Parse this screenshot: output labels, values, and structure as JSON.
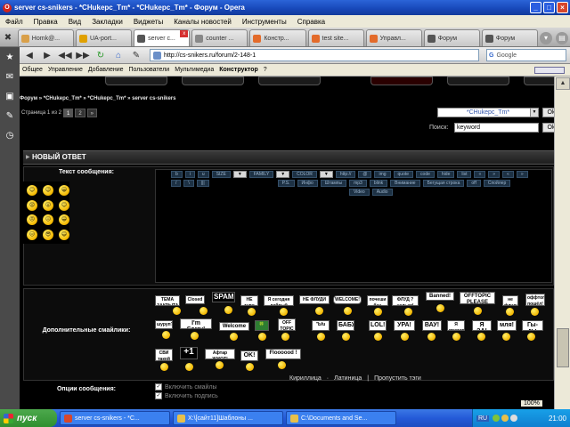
{
  "window": {
    "title": "server cs-snikers - *CHukepc_Tm* - *CHukepc_Tm* - Форум - Opera",
    "minimize": "_",
    "maximize": "□",
    "close": "×"
  },
  "menu": [
    "Файл",
    "Правка",
    "Вид",
    "Закладки",
    "Виджеты",
    "Каналы новостей",
    "Инструменты",
    "Справка"
  ],
  "tabs": [
    {
      "label": "Homk@...",
      "color": "#d9a04a"
    },
    {
      "label": "UA-port...",
      "color": "#e0a000"
    },
    {
      "label": "server c...",
      "color": "#555555",
      "active": true
    },
    {
      "label": "counter ...",
      "color": "#888888"
    },
    {
      "label": "Констр...",
      "color": "#e36b2b"
    },
    {
      "label": "test site...",
      "color": "#e36b2b"
    },
    {
      "label": "Управл...",
      "color": "#e36b2b"
    },
    {
      "label": "Форум",
      "color": "#555555"
    },
    {
      "label": "Форум",
      "color": "#555555"
    }
  ],
  "nav": {
    "url": "http://cs-snikers.ru/forum/2-148-1",
    "search_placeholder": "Google"
  },
  "bookmarks": [
    "Общее",
    "Управление",
    "Добавление",
    "Пользователи",
    "Мультимедиа",
    "Конструктор",
    "?"
  ],
  "forum": {
    "breadcrumb": "Форум » *CHukepc_Tm* » *CHukepc_Tm* » server cs-snikers",
    "pager_label": "Страница 1 из 2",
    "pages": [
      "1",
      "2",
      "»"
    ],
    "user_select": "*CHukepc_Tm*",
    "ok": "Ok",
    "search_label": "Поиск:",
    "search_value": "keyword",
    "reply_header": "НОВЫЙ ОТВЕТ",
    "msg_label": "Текст сообщения:",
    "extra_label": "Дополнительные смайлики:",
    "opts_label": "Опции сообщения:"
  },
  "bbcodes_row1": [
    "b",
    "i",
    "u",
    "SIZE",
    "FAMILY",
    "COLOR",
    "http://",
    "@",
    "img",
    "quote",
    "code",
    "hide",
    "list",
    "«",
    "»",
    "«",
    "»",
    "/",
    "\\",
    "|||"
  ],
  "bbcodes_row2": [
    "P.S.",
    "Инфо",
    "Штампы",
    "mp3",
    "blink",
    "Внимание",
    "Бегущая строка",
    "off",
    "Спойлер"
  ],
  "bbcodes_row3": [
    "Video",
    "Audio"
  ],
  "smileys": [
    "😊",
    "😉",
    "😀",
    "😟",
    "😮",
    "😊",
    "😠",
    "😐",
    "😁",
    "😑",
    "😎",
    "😄"
  ],
  "signs": [
    "ТЕМА ЗАКРЫТА",
    "Closed",
    "SPAM",
    "НЕ тупи",
    "Я сегодня добрый",
    "НЕ ФЛУДИ",
    "WELCOME!",
    "почеши бан",
    "ФЛУД ? нельзя!",
    "Banned!",
    "OFFTOPIC PLEASE",
    "не флуди",
    "оффтоп пошёл!",
    "шуруп?",
    "I'm Sorry!",
    "Welcome",
    "🍀",
    "OFF TOPIC",
    "\"Ьfu",
    "БАБУ",
    "LOL!",
    "УРА!",
    "ВАУ!",
    "Я против",
    "Я ЗА!",
    "мля!",
    "Гы-гы",
    "СВИ такой",
    "+1",
    "Афтар ЖЖОТ!",
    "OK!",
    "Floooood !"
  ],
  "lang_links": [
    "Кириллица",
    "·",
    "Латиница",
    "|",
    "Пропустить тэги"
  ],
  "options": [
    "Включить смайлы",
    "Включить подпись"
  ],
  "taskbar": {
    "start": "пуск",
    "tasks": [
      {
        "label": "server cs-snikers - *C...",
        "color": "#d6472c"
      },
      {
        "label": "X:\\[сайт11]Шаблоны ...",
        "color": "#e8c04a"
      },
      {
        "label": "C:\\Documents and Se...",
        "color": "#e8c04a"
      }
    ],
    "lang": "RU",
    "clock": "21:00"
  },
  "zoom": "100%"
}
